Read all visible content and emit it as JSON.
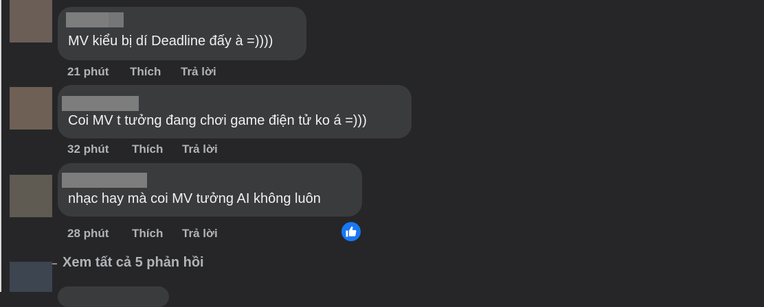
{
  "comments": [
    {
      "text": "MV kiểu bị dí Deadline đấy à =))))",
      "time": "21 phút",
      "like_label": "Thích",
      "reply_label": "Trả lời"
    },
    {
      "text": "Coi MV t tưởng đang chơi game điện tử ko á =)))",
      "time": "32 phút",
      "like_label": "Thích",
      "reply_label": "Trả lời"
    },
    {
      "text": "nhạc hay mà coi MV tưởng AI không luôn",
      "time": "28 phút",
      "like_label": "Thích",
      "reply_label": "Trả lời"
    }
  ],
  "view_replies": "Xem tất cả 5 phản hồi",
  "icons": {
    "reaction": "thumbs-up-icon"
  },
  "colors": {
    "background": "#262628",
    "bubble": "#3a3b3c",
    "reaction": "#1877f2"
  }
}
